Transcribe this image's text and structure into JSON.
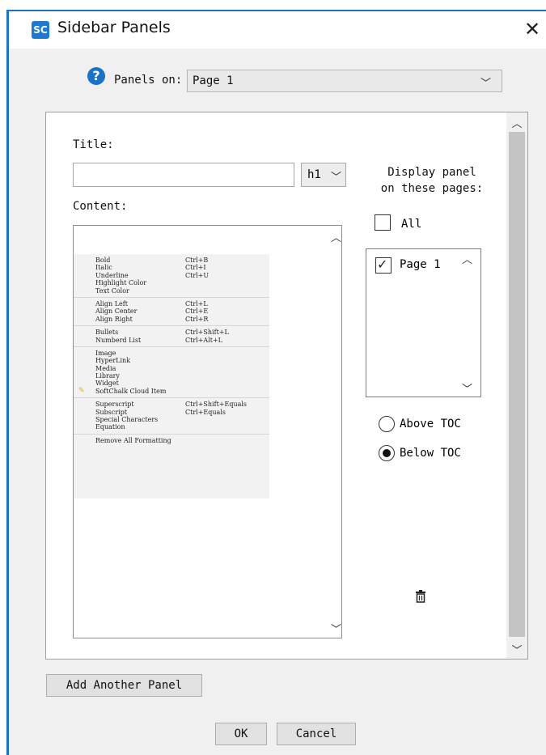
{
  "window": {
    "title": "Sidebar Panels",
    "app_icon": "softchalk-icon",
    "app_icon_text": "SC",
    "close_symbol": "✕",
    "accent_color": "#1a73c8"
  },
  "panels_on": {
    "label": "Panels on:",
    "help_symbol": "?",
    "value": "Page 1"
  },
  "panel": {
    "title_label": "Title:",
    "title_value": "",
    "heading_value": "h1",
    "content_label": "Content:",
    "display_label_line1": "Display panel",
    "display_label_line2": "on these pages:",
    "all_label": "All",
    "all_checked": false,
    "pages": [
      {
        "label": "Page 1",
        "checked": true
      }
    ],
    "position_options": {
      "above": "Above TOC",
      "below": "Below TOC",
      "selected": "below"
    }
  },
  "context_menu": {
    "groups": [
      [
        {
          "label": "Bold",
          "shortcut": "Ctrl+B"
        },
        {
          "label": "Italic",
          "shortcut": "Ctrl+I"
        },
        {
          "label": "Underline",
          "shortcut": "Ctrl+U"
        },
        {
          "label": "Highlight Color",
          "shortcut": ""
        },
        {
          "label": "Text Color",
          "shortcut": ""
        }
      ],
      [
        {
          "label": "Align Left",
          "shortcut": "Ctrl+L"
        },
        {
          "label": "Align Center",
          "shortcut": "Ctrl+E"
        },
        {
          "label": "Align Right",
          "shortcut": "Ctrl+R"
        }
      ],
      [
        {
          "label": "Bullets",
          "shortcut": "Ctrl+Shift+L"
        },
        {
          "label": "Numberd List",
          "shortcut": "Ctrl+Alt+L"
        }
      ],
      [
        {
          "label": "Image",
          "shortcut": ""
        },
        {
          "label": "HyperLink",
          "shortcut": ""
        },
        {
          "label": "Media",
          "shortcut": ""
        },
        {
          "label": "Library",
          "shortcut": ""
        },
        {
          "label": "Widget",
          "shortcut": ""
        },
        {
          "label": "SoftChalk Cloud Item",
          "shortcut": "",
          "icon": "pencil-icon"
        }
      ],
      [
        {
          "label": "Superscript",
          "shortcut": "Ctrl+Shift+Equals"
        },
        {
          "label": "Subscript",
          "shortcut": "Ctrl+Equals"
        },
        {
          "label": "Special Characters",
          "shortcut": ""
        },
        {
          "label": "Equation",
          "shortcut": ""
        }
      ],
      [
        {
          "label": "Remove All Formatting",
          "shortcut": ""
        }
      ]
    ]
  },
  "buttons": {
    "add_panel": "Add Another Panel",
    "ok": "OK",
    "cancel": "Cancel"
  }
}
